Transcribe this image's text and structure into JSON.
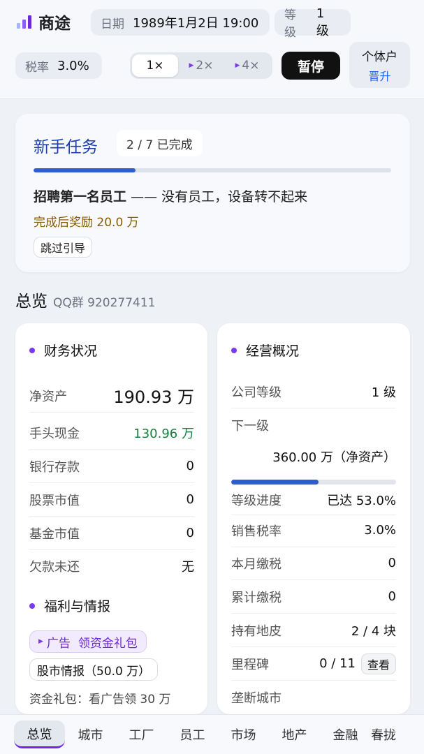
{
  "header": {
    "app_title": "商途",
    "date_label": "日期",
    "date_value": "1989年1月2日 19:00",
    "level_label": "等级",
    "level_value": "1 级",
    "tax_label": "税率",
    "tax_value": "3.0%",
    "speeds": [
      "1×",
      "2×",
      "4×"
    ],
    "active_speed": "1×",
    "pause_label": "暂停",
    "entity_type": "个体户",
    "upgrade_label": "晋升",
    "logo_colors": [
      "#a5b4fc",
      "#8b5cf6",
      "#6d28d9"
    ]
  },
  "guide": {
    "title": "新手任务",
    "progress_text": "2 / 7 已完成",
    "progress_fraction": 0.2857,
    "task_name": "招聘第一名员工",
    "task_desc": "—— 没有员工，设备转不起来",
    "reward": "完成后奖励 20.0 万",
    "skip_label": "跳过引导"
  },
  "overview": {
    "title": "总览",
    "qq_group": "QQ群 920277411"
  },
  "finance": {
    "title": "财务状况",
    "rows": [
      {
        "label": "净资产",
        "value": "190.93 万"
      },
      {
        "label": "手头现金",
        "value": "130.96 万"
      },
      {
        "label": "银行存款",
        "value": "0"
      },
      {
        "label": "股票市值",
        "value": "0"
      },
      {
        "label": "基金市值",
        "value": "0"
      },
      {
        "label": "欠款未还",
        "value": "无"
      }
    ]
  },
  "welfare": {
    "title": "福利与情报",
    "ad_label": "广告",
    "ad_text": "领资金礼包",
    "tip_label": "股市情报（50.0 万）",
    "gift_line": "资金礼包：看广告领 30 万"
  },
  "business": {
    "title": "经营概况",
    "company_level_label": "公司等级",
    "company_level_value": "1 级",
    "next_level_label": "下一级",
    "next_level_value": "360.00 万（净资产）",
    "progress_label": "等级进度",
    "progress_value": "已达 53.0%",
    "progress_fraction": 0.53,
    "rows": [
      {
        "label": "销售税率",
        "value": "3.0%"
      },
      {
        "label": "本月缴税",
        "value": "0"
      },
      {
        "label": "累计缴税",
        "value": "0"
      },
      {
        "label": "持有地皮",
        "value": "2 / 4 块"
      }
    ],
    "milestone_label": "里程碑",
    "milestone_value": "0 / 11",
    "view_label": "查看",
    "city_label": "垄断城市"
  },
  "nav": {
    "items": [
      "总览",
      "城市",
      "工厂",
      "员工",
      "市场",
      "地产",
      "金融",
      "春拢"
    ],
    "active": "总览"
  }
}
